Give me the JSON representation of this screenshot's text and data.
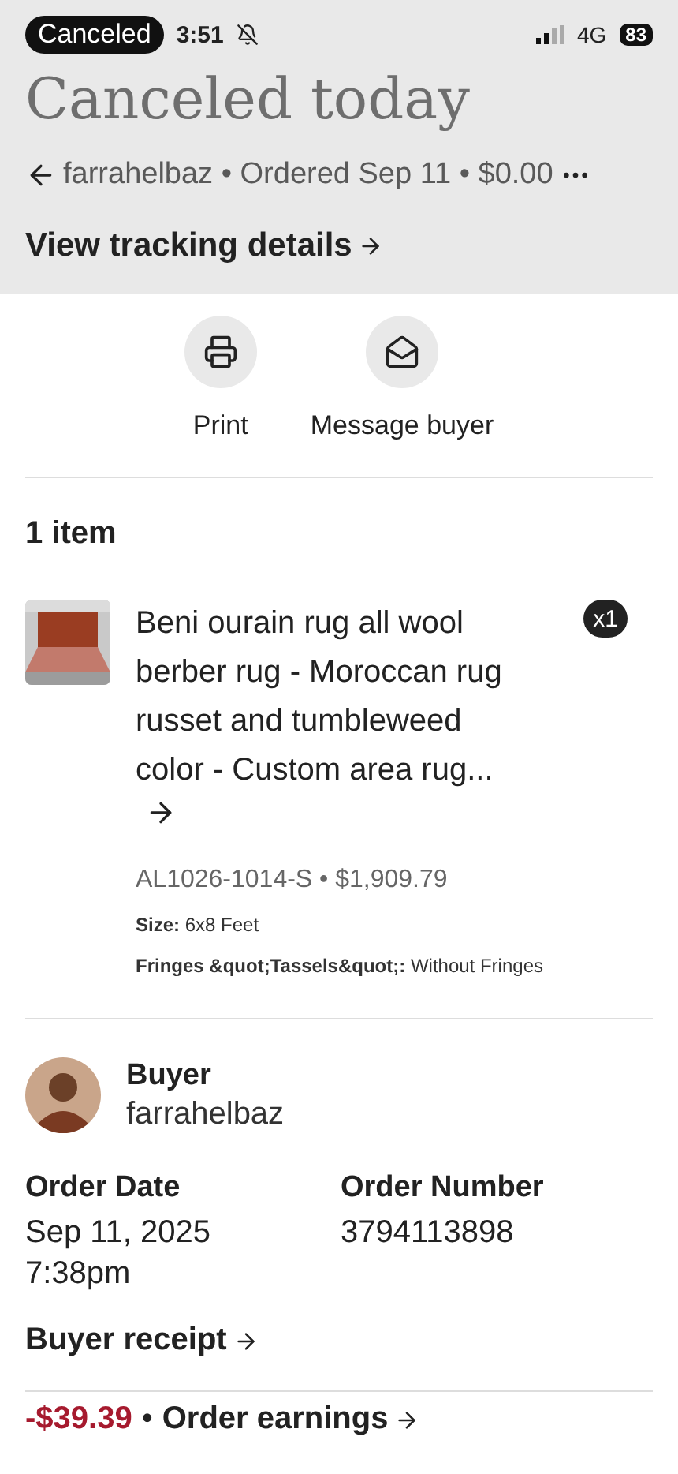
{
  "status_bar": {
    "badge": "Canceled",
    "time": "3:51",
    "network": "4G",
    "battery": "83"
  },
  "header": {
    "title": "Canceled today",
    "summary": "farrahelbaz • Ordered Sep 11 • $0.00",
    "link": "View tracking details"
  },
  "actions": [
    {
      "kind": "print",
      "label": "Print"
    },
    {
      "kind": "message",
      "label": "Message buyer"
    }
  ],
  "items_heading": "1 item",
  "items": [
    {
      "title": "Beni ourain rug all wool berber rug - Moroccan rug russet and tumbleweed color - Custom area rug...",
      "quantity": "x1",
      "sku_price": "AL1026-1014-S • $1,909.79",
      "options": [
        "**Size:** 6x8 Feet",
        "**Fringes &quot;Tassels&quot;:** Without Fringes"
      ]
    }
  ],
  "buyer": {
    "label": "Buyer",
    "name": "farrahelbaz"
  },
  "order_details": [
    {
      "label": "Order Date",
      "value": "Sep 11, 2025 7:38pm"
    },
    {
      "label": "Order Number",
      "value": "3794113898"
    }
  ],
  "receipt_link": "Buyer receipt",
  "earnings": {
    "amount": "-$39.39",
    "separator": "•",
    "label": "Order earnings"
  }
}
